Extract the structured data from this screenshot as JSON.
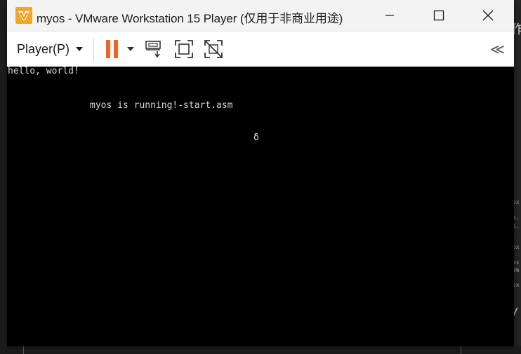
{
  "window": {
    "title": "myos - VMware Workstation 15 Player (仅用于非商业用途)"
  },
  "toolbar": {
    "player_menu": "Player(P)",
    "collapse": "≪"
  },
  "console": {
    "lines": [
      "hello, world!",
      "myos is running!-start.asm",
      "δ"
    ]
  },
  "colors": {
    "pause": "#f26522",
    "app_icon": "#f5a623",
    "screen": "#000000"
  },
  "background_fragments": [
    "作",
    "ex",
    "s.",
    "s.",
    "ex",
    "ex",
    "96",
    "ex",
    "/."
  ]
}
